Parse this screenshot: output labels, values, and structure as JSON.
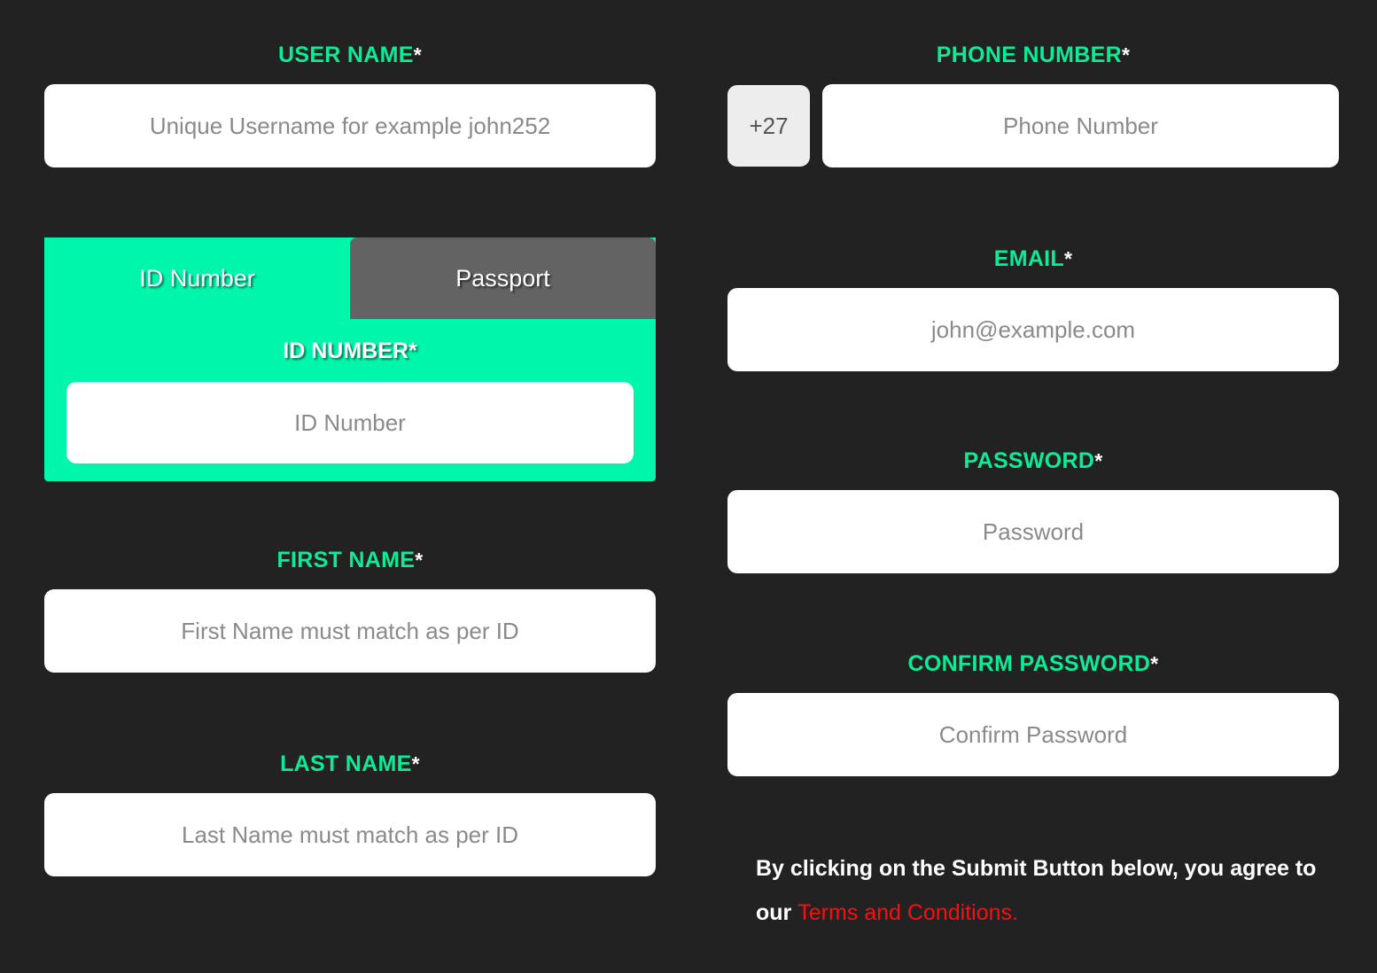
{
  "theme": {
    "background": "#222222",
    "accent_green": "#00F7AB",
    "label_green": "#0DEB97",
    "inactive_tab_gray": "#636363",
    "link_red": "#FF0D0D",
    "input_background": "#FFFFFF",
    "placeholder_gray": "#8A8A8A",
    "prefix_gray": "#EDEDED"
  },
  "left_column": {
    "username": {
      "label": "USER NAME",
      "required_mark": "*",
      "placeholder": "Unique Username for example john252",
      "value": ""
    },
    "identity": {
      "tabs": [
        {
          "label": "ID Number",
          "active": true
        },
        {
          "label": "Passport",
          "active": false
        }
      ],
      "panel_label": "ID NUMBER",
      "panel_required_mark": "*",
      "placeholder": "ID Number",
      "value": ""
    },
    "first_name": {
      "label": "FIRST NAME",
      "required_mark": "*",
      "placeholder": "First Name must match as per ID",
      "value": ""
    },
    "last_name": {
      "label": "LAST NAME",
      "required_mark": "*",
      "placeholder": "Last Name must match as per ID",
      "value": ""
    }
  },
  "right_column": {
    "phone": {
      "label": "PHONE NUMBER",
      "required_mark": "*",
      "country_code": "+27",
      "placeholder": "Phone Number",
      "value": ""
    },
    "email": {
      "label": "EMAIL",
      "required_mark": "*",
      "placeholder": "john@example.com",
      "value": ""
    },
    "password": {
      "label": "PASSWORD",
      "required_mark": "*",
      "placeholder": "Password",
      "value": ""
    },
    "confirm_password": {
      "label": "CONFIRM PASSWORD",
      "required_mark": "*",
      "placeholder": "Confirm Password",
      "value": ""
    },
    "terms": {
      "text": "By clicking on the Submit Button below, you agree to our ",
      "link_text": "Terms and Conditions."
    }
  }
}
